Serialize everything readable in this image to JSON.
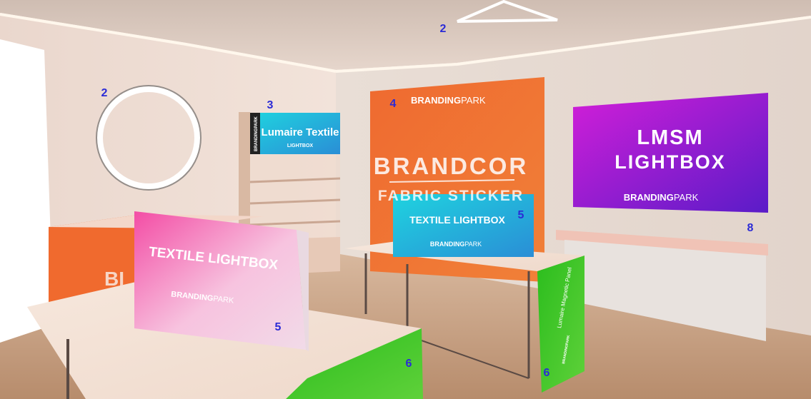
{
  "callouts": {
    "ceiling_light": "2",
    "ring_light": "2",
    "shelf_lightbox": "3",
    "backdrop": "4",
    "pink_lightbox": "5",
    "teal_lightbox": "5",
    "green_panel_left": "6",
    "green_panel_right": "6",
    "shelf": "8"
  },
  "shelf_lightbox": {
    "title": "Lumaire Textile",
    "subtitle": "LIGHTBOX",
    "side_brand": "BRANDINGPARK"
  },
  "backdrop": {
    "brand_bold": "BRANDING",
    "brand_light": "PARK",
    "title": "BRANDCOR",
    "subtitle": "FABRIC STICKER"
  },
  "wall_lightbox": {
    "line1": "LMSM",
    "line2": "LIGHTBOX",
    "brand_bold": "BRANDING",
    "brand_light": "PARK"
  },
  "teal_lightbox": {
    "title": "TEXTILE LIGHTBOX",
    "brand_bold": "BRANDING",
    "brand_light": "PARK"
  },
  "pink_lightbox": {
    "title": "TEXTILE LIGHTBOX",
    "brand_bold": "BRANDING",
    "brand_light": "PARK"
  },
  "counter_left": {
    "text": "BI"
  },
  "green_panel": {
    "text": "Lumaire Magnetic Panel",
    "brand": "BRANDINGPARK"
  },
  "colors": {
    "callout": "#2b2bd6",
    "orange": "#f0662c",
    "magenta": "#c51fd6",
    "violet": "#6a1fd0",
    "teal": "#27c9d9",
    "pink": "#f06ab4",
    "green": "#3fc12b",
    "wall": "#ecdcd3",
    "floor": "#c9a285"
  }
}
